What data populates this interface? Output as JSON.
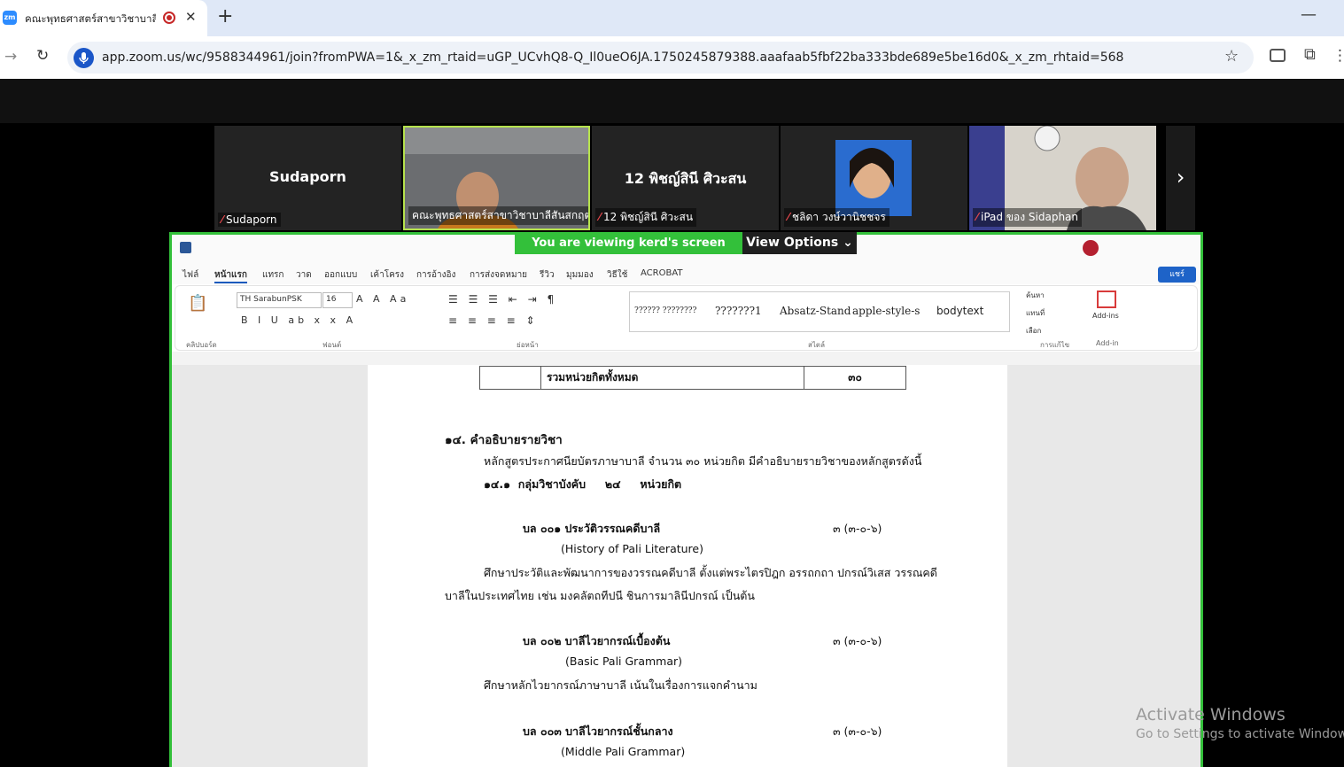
{
  "browser": {
    "tab_title": "คณะพุทธศาสตร์สาขาวิชาบาลีสันสกฤต",
    "tab_favicon": "zm",
    "url": "app.zoom.us/wc/9588344961/join?fromPWA=1&_x_zm_rtaid=uGP_UCvhQ8-Q_Il0ueO6JA.1750245879388.aaafaab5fbf22ba333bde689e5be16d0&_x_zm_rhtaid=568",
    "icons": {
      "new_tab": "+",
      "close_tab": "✕",
      "back": "→",
      "reload": "↻",
      "star": "☆",
      "minimize": "—",
      "extensions": "⧉",
      "more": "⋮"
    }
  },
  "participants": [
    {
      "big_name": "Sudaporn",
      "label": "Sudaporn",
      "muted": true
    },
    {
      "big_name": "",
      "label": "คณะพุทธศาสตร์สาขาวิชาบาลีสันสกฤต",
      "muted": false
    },
    {
      "big_name": "12 พิชญ์สินี ศิวะสน",
      "label": "12 พิชญ์สินี ศิวะสน",
      "muted": true
    },
    {
      "big_name": "",
      "label": "ชลิดา วงษ์วานิชชจร",
      "muted": true
    },
    {
      "big_name": "",
      "label": "iPad ของ Sidaphan",
      "muted": true
    }
  ],
  "share": {
    "banner": "You are viewing  kerd's screen",
    "view_options": "View Options"
  },
  "word": {
    "tabs": [
      "ไฟล์",
      "หน้าแรก",
      "แทรก",
      "วาด",
      "ออกแบบ",
      "เค้าโครง",
      "การอ้างอิง",
      "การส่งจดหมาย",
      "รีวิว",
      "มุมมอง",
      "วิธีใช้",
      "ACROBAT"
    ],
    "share_button": "แชร์",
    "font_name": "TH SarabunPSK",
    "font_size": "16",
    "group_labels": [
      "คลิปบอร์ด",
      "ฟอนต์",
      "ย่อหน้า",
      "สไตล์",
      "การแก้ไข",
      "Add-in"
    ],
    "styles": [
      "?????? ????????",
      "???????1",
      "Absatz-Stand",
      "apple-style-s",
      "bodytext"
    ],
    "editing": [
      "ค้นหา",
      "แทนที่",
      "เลือก"
    ],
    "addins": "Add-ins"
  },
  "document": {
    "table_total_label": "รวมหน่วยกิตทั้งหมด",
    "table_total_value": "๓๐",
    "section_heading": "๑๔. คำอธิบายรายวิชา",
    "intro": "หลักสูตรประกาศนียบัตรภาษาบาลี จำนวน ๓๐ หน่วยกิต มีคำอธิบายรายวิชาของหลักสูตรดังนี้",
    "group_heading": "๑๔.๑  กลุ่มวิชาบังคับ     ๒๔     หน่วยกิต",
    "courses": [
      {
        "title": "บล ๐๐๑ ประวัติวรรณคดีบาลี",
        "credits": "๓ (๓-๐-๖)",
        "english": "(History of Pali Literature)"
      },
      {
        "title": "บล ๐๐๒ บาลีไวยากรณ์เบื้องต้น",
        "credits": "๓ (๓-๐-๖)",
        "english": "(Basic Pali Grammar)"
      },
      {
        "title": "บล ๐๐๓ บาลีไวยากรณ์ชั้นกลาง",
        "credits": "๓ (๓-๐-๖)",
        "english": "(Middle Pali Grammar)"
      }
    ],
    "course1_desc_line1": "ศึกษาประวัติและพัฒนาการของวรรณคดีบาลี ตั้งแต่พระไตรปิฎก อรรถกถา ปกรณ์วิเสส วรรณคดี",
    "course1_desc_line2": "บาลีในประเทศไทย เช่น มงคลัตถทีปนี ชินการมาลินีปกรณ์ เป็นต้น",
    "course2_desc": "ศึกษาหลักไวยากรณ์ภาษาบาลี เน้นในเรื่องการแจกคำนาม"
  },
  "watermark": {
    "title": "Activate Windows",
    "subtitle": "Go to Settings to activate Windows."
  }
}
